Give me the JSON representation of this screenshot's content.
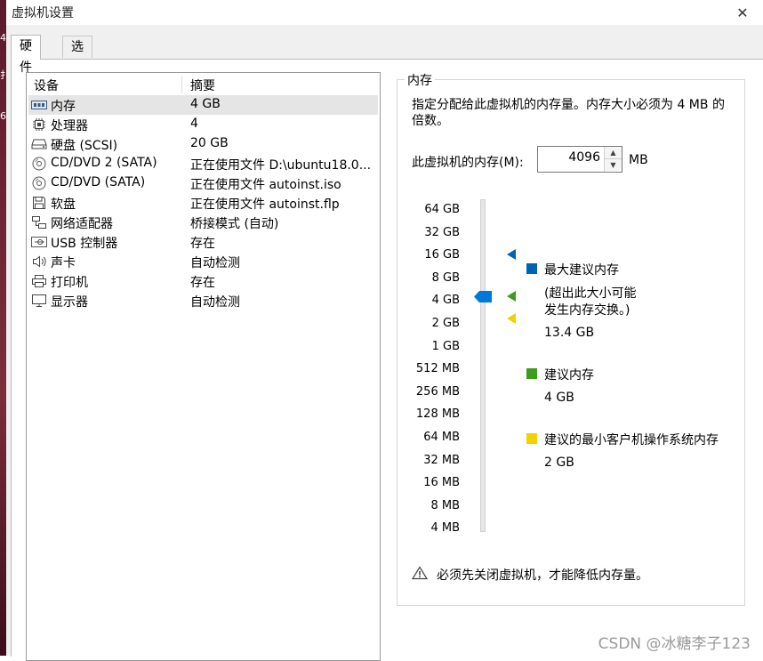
{
  "window": {
    "title": "虚拟机设置",
    "close_glyph": "✕"
  },
  "tabs": [
    {
      "label": "硬件",
      "active": true
    },
    {
      "label": "选项",
      "active": false
    }
  ],
  "device_list": {
    "columns": [
      "设备",
      "摘要"
    ],
    "rows": [
      {
        "icon": "memory-icon",
        "device": "内存",
        "summary": "4 GB",
        "selected": true
      },
      {
        "icon": "processor-icon",
        "device": "处理器",
        "summary": "4"
      },
      {
        "icon": "harddisk-icon",
        "device": "硬盘 (SCSI)",
        "summary": "20 GB"
      },
      {
        "icon": "cd-dvd-icon",
        "device": "CD/DVD 2 (SATA)",
        "summary": "正在使用文件 D:\\ubuntu18.0..."
      },
      {
        "icon": "cd-dvd-icon",
        "device": "CD/DVD (SATA)",
        "summary": "正在使用文件 autoinst.iso"
      },
      {
        "icon": "floppy-icon",
        "device": "软盘",
        "summary": "正在使用文件 autoinst.flp"
      },
      {
        "icon": "network-adapter-icon",
        "device": "网络适配器",
        "summary": "桥接模式 (自动)"
      },
      {
        "icon": "usb-icon",
        "device": "USB 控制器",
        "summary": "存在"
      },
      {
        "icon": "speaker-icon",
        "device": "声卡",
        "summary": "自动检测"
      },
      {
        "icon": "printer-icon",
        "device": "打印机",
        "summary": "存在"
      },
      {
        "icon": "display-icon",
        "device": "显示器",
        "summary": "自动检测"
      }
    ]
  },
  "memory": {
    "group_title": "内存",
    "description": "指定分配给此虚拟机的内存量。内存大小必须为 4 MB 的倍数。",
    "field_label": "此虚拟机的内存(M):",
    "field_value": "4096",
    "unit": "MB",
    "scale_ticks": [
      "64 GB",
      "32 GB",
      "16 GB",
      "8 GB",
      "4 GB",
      "2 GB",
      "1 GB",
      "512 MB",
      "256 MB",
      "128 MB",
      "64 MB",
      "32 MB",
      "16 MB",
      "8 MB",
      "4 MB"
    ],
    "slider_value": "4 GB",
    "legend": {
      "max": {
        "label": "最大建议内存",
        "note_line1": "(超出此大小可能",
        "note_line2": "发生内存交换。)",
        "value": "13.4 GB",
        "color": "#0063b1"
      },
      "recommended": {
        "label": "建议内存",
        "value": "4 GB",
        "color": "#3d9b1d"
      },
      "min_guest": {
        "label": "建议的最小客户机操作系统内存",
        "value": "2 GB",
        "color": "#f2d100"
      }
    },
    "warning": "必须先关闭虚拟机，才能降低内存量。"
  },
  "watermark": "CSDN @冰糖李子123"
}
